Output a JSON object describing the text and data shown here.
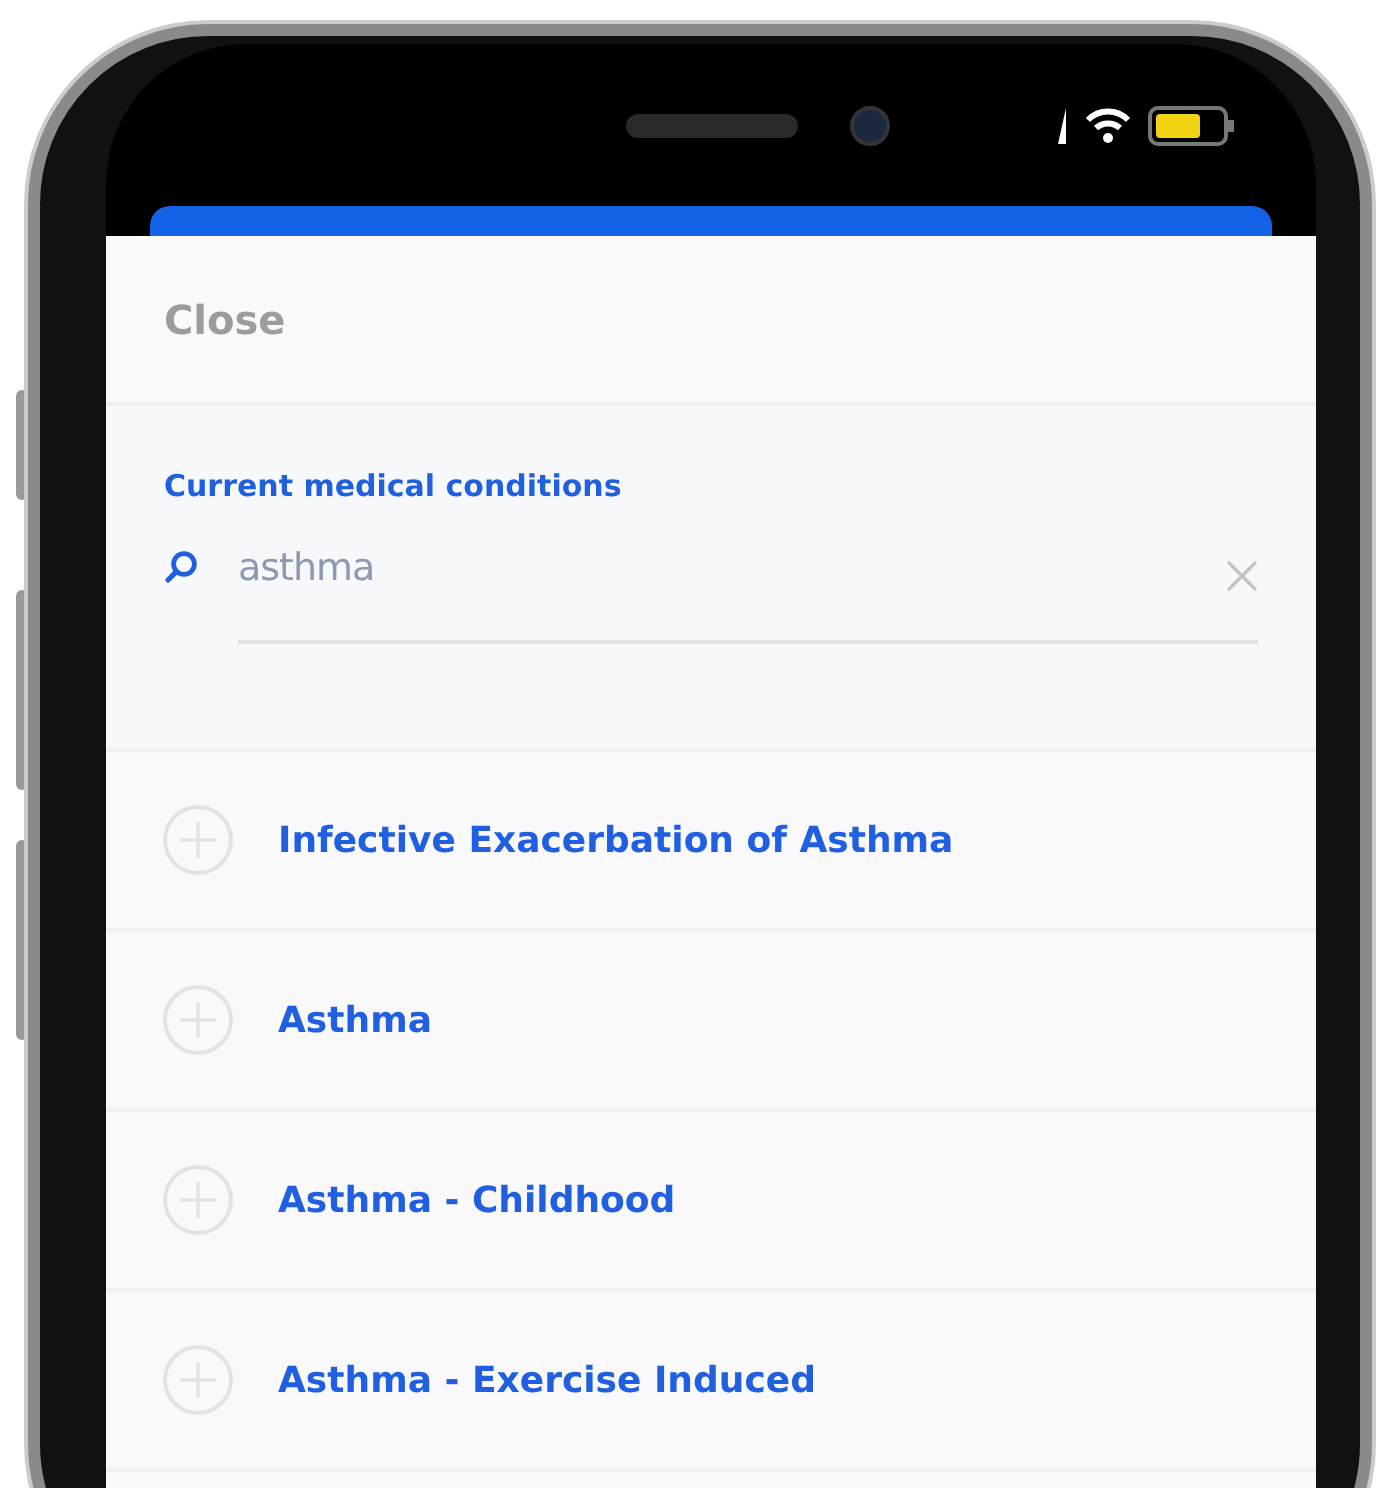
{
  "header": {
    "close_label": "Close"
  },
  "search": {
    "label": "Current medical conditions",
    "value": "asthma"
  },
  "results": [
    {
      "label": "Infective Exacerbation of Asthma"
    },
    {
      "label": "Asthma"
    },
    {
      "label": "Asthma - Childhood"
    },
    {
      "label": "Asthma - Exercise Induced"
    }
  ]
}
